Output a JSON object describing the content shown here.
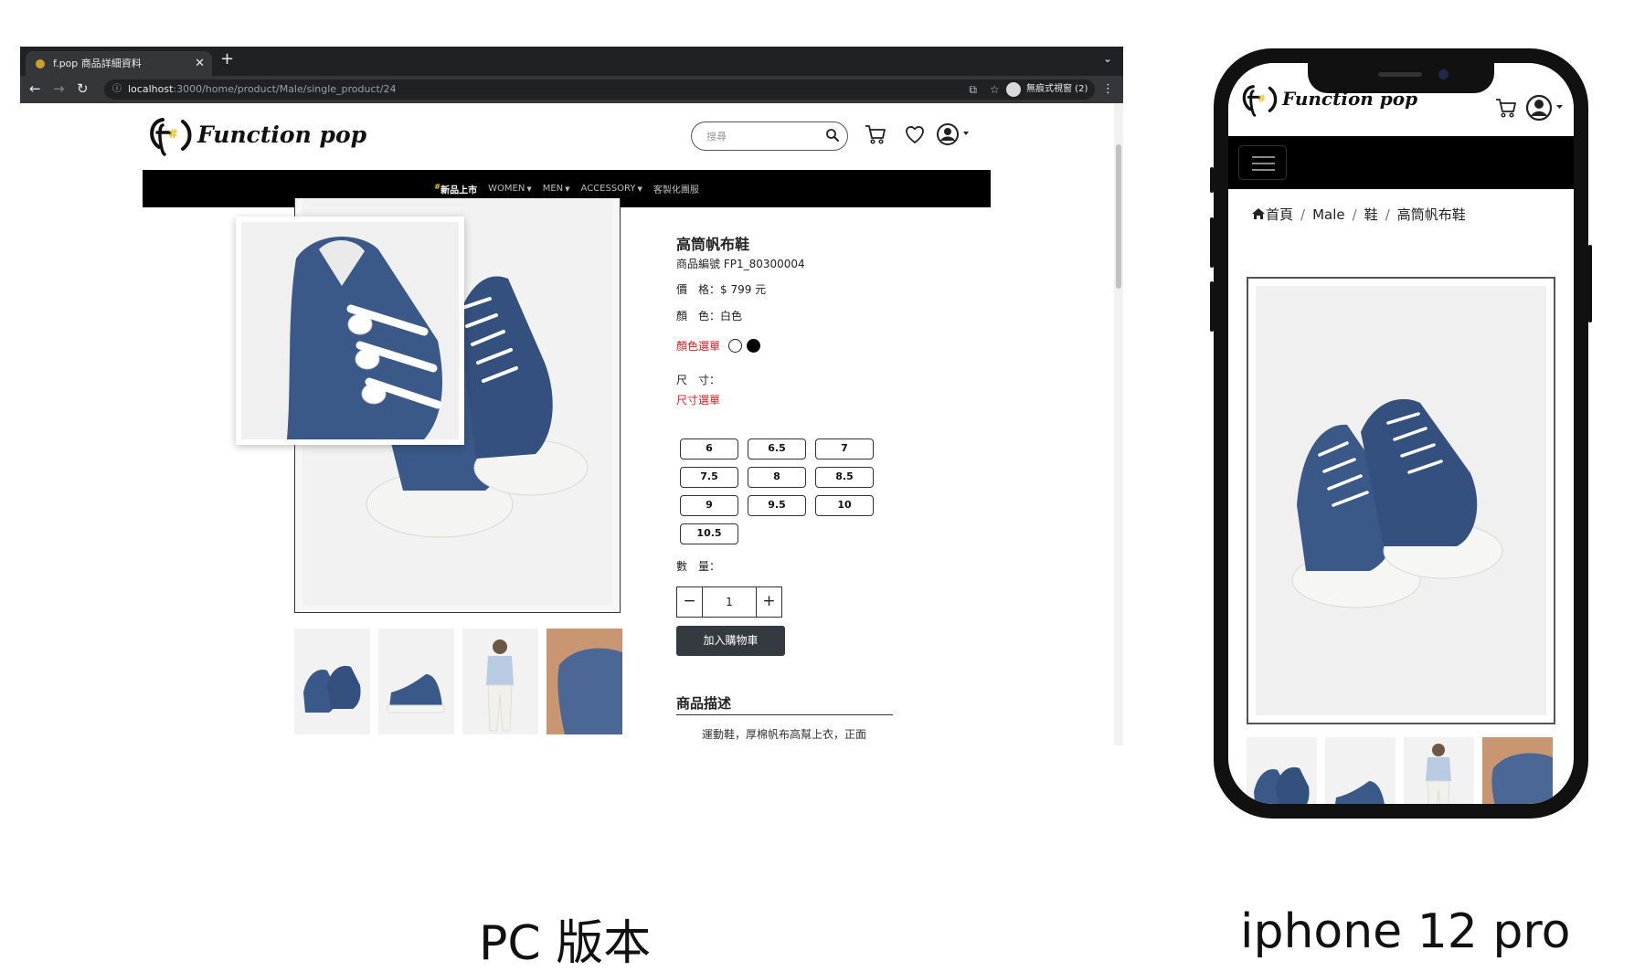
{
  "browser": {
    "tab_title": "f.pop 商品詳細資料",
    "url_host": "localhost",
    "url_path": ":3000/home/product/Male/single_product/24",
    "incognito_label": "無痕式視窗 (2)"
  },
  "site": {
    "logo_text": "Function pop",
    "search_placeholder": "搜尋",
    "nav": {
      "new_hash": "#",
      "new_label": "新品上市",
      "items": [
        "WOMEN",
        "MEN",
        "ACCESSORY"
      ],
      "custom_label": "客製化團服"
    }
  },
  "product": {
    "title": "高筒帆布鞋",
    "code_line": "商品編號 FP1_80300004",
    "price_line": "價　格：$ 799 元",
    "color_line": "顏　色：白色",
    "color_select_label": "顏色選單",
    "swatches": [
      "#ffffff",
      "#000000"
    ],
    "size_label": "尺　寸：",
    "size_select_label": "尺寸選單",
    "sizes": [
      "6",
      "6.5",
      "7",
      "7.5",
      "8",
      "8.5",
      "9",
      "9.5",
      "10",
      "10.5"
    ],
    "qty_label": "數　量：",
    "qty_minus": "−",
    "qty_value": "1",
    "qty_plus": "+",
    "add_to_cart": "加入購物車",
    "desc_title": "商品描述",
    "desc_text": "運動鞋，厚棉帆布高幫上衣，正面"
  },
  "mobile": {
    "logo_text": "Function pop",
    "breadcrumb": [
      "首頁",
      "Male",
      "鞋",
      "高筒帆布鞋"
    ],
    "breadcrumb_sep": "/"
  },
  "captions": {
    "pc": "PC 版本",
    "phone": "iphone 12 pro"
  },
  "colors": {
    "nav_bg": "#000000",
    "cart_button": "#343a40",
    "accent_red": "#e02020",
    "logo_yellow": "#f3c21a",
    "shoe_blue": "#3a5888"
  }
}
